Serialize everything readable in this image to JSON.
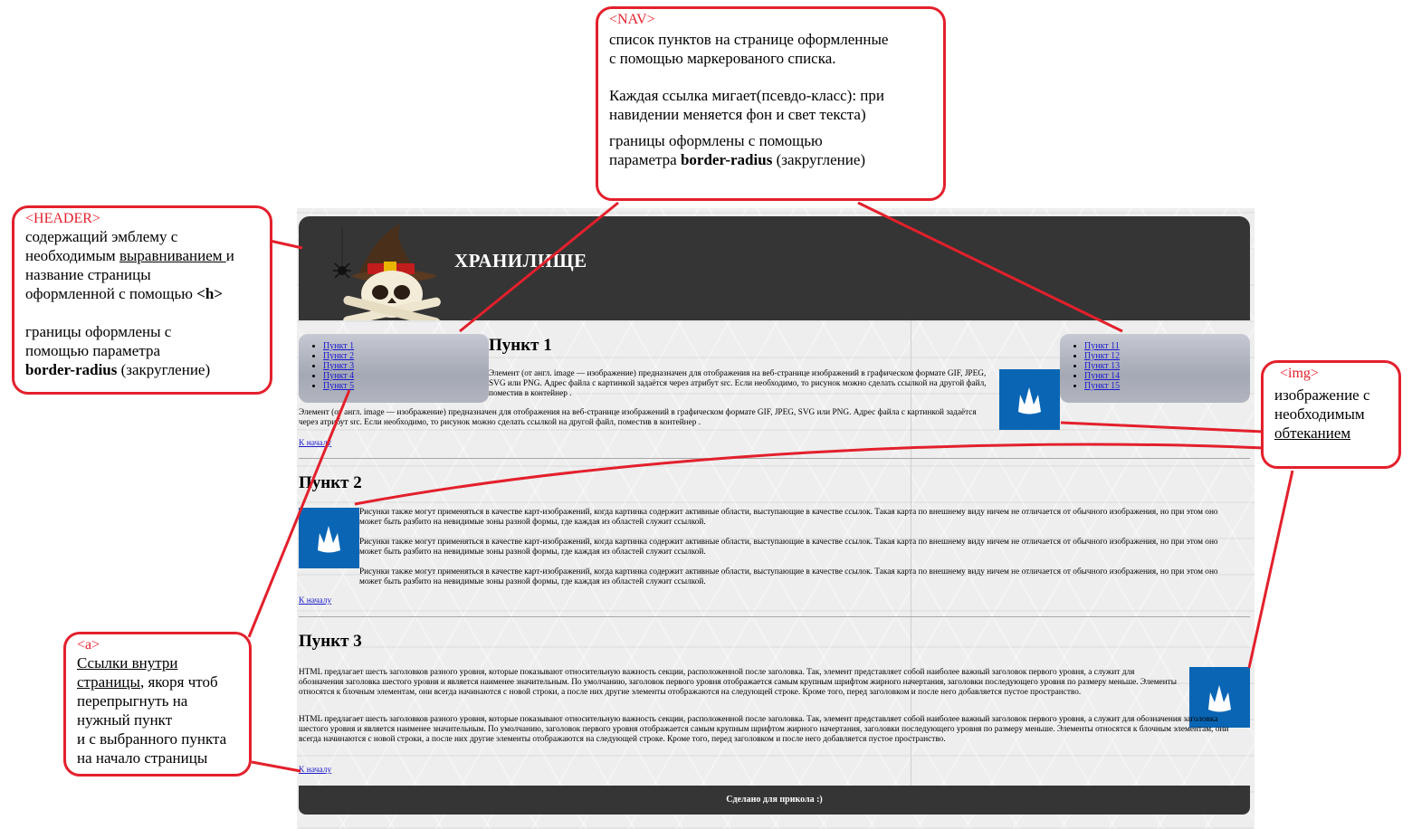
{
  "site": {
    "title": "ХРАНИЛИЩЕ",
    "nav_left": [
      "Пункт 1",
      "Пункт 2",
      "Пункт 3",
      "Пункт 4",
      "Пункт 5"
    ],
    "nav_right": [
      "Пункт 11",
      "Пункт 12",
      "Пункт 13",
      "Пункт 14",
      "Пункт 15"
    ],
    "section1": {
      "heading": "Пункт 1",
      "text_a": "Элемент  (от англ. image — изображение) предназначен для отображения на веб-странице изображений в графическом формате GIF, JPEG, SVG или PNG. Адрес файла с картинкой задаётся через атрибут src. Если необходимо, то рисунок можно сделать ссылкой на другой файл, поместив  в контейнер .",
      "text_b": "Элемент  (от англ. image — изображение) предназначен для отображения на веб-странице изображений в графическом формате GIF, JPEG, SVG или PNG. Адрес файла с картинкой задаётся через атрибут src. Если необходимо, то рисунок можно сделать ссылкой на другой файл, поместив  в контейнер .",
      "back": "К началу"
    },
    "section2": {
      "heading": "Пункт 2",
      "paragraph": "Рисунки также могут применяться в качестве карт-изображений, когда картинка содержит активные области, выступающие в качестве ссылок. Такая карта по внешнему виду ничем не отличается от обычного изображения, но при этом оно может быть разбито на невидимые зоны разной формы, где каждая из областей служит ссылкой.",
      "back": "К началу"
    },
    "section3": {
      "heading": "Пункт 3",
      "paragraph": "HTML предлагает шесть заголовков разного уровня, которые показывают относительную важность секции, расположенной после заголовка. Так, элемент представляет собой наиболее важный заголовок первого уровня, а служит для обозначения заголовка шестого уровня и является наименее значительным. По умолчанию, заголовок первого уровня отображается самым крупным шрифтом жирного начертания, заголовки последующего уровня по размеру меньше. Элементы относятся к блочным элементам, они всегда начинаются с новой строки, а после них другие элементы отображаются на следующей строке. Кроме того, перед заголовком и после него добавляется пустое пространство.",
      "back": "К началу"
    },
    "footer": "Сделано для прикола :)"
  },
  "callouts": {
    "nav": {
      "tag": "<NAV>",
      "line1": "список пунктов на странице оформленные",
      "line2": "с помощью маркерованого списка.",
      "line3": "Каждая ссылка мигает(псевдо-класс): при",
      "line4": "навидении меняется фон и свет текста)",
      "line5": "границы оформлены с  помощью",
      "line6_pre": "параметра ",
      "line6_bold": "border-radius",
      "line6_post": " (закругление)"
    },
    "header": {
      "tag": "<HEADER>",
      "line1": "содержащий эмблему с",
      "line2_pre": "необходимым ",
      "line2_u": "выравниванием ",
      "line2_post": "и",
      "line3": "название страницы",
      "line4_pre": "оформленной с помощью ",
      "line4_bold": "<h>",
      "line5": "границы оформлены с",
      "line6": "помощью параметра",
      "line7_bold": "border-radius",
      "line7_post": " (закругление)"
    },
    "img": {
      "tag": "<img>",
      "line1": "изображение с",
      "line2": "необходимым",
      "line3": "обтеканием"
    },
    "a": {
      "tag": "<a>",
      "line1": "Ссылки внутри ",
      "line2_u": "страницы",
      "line2_post": ", якоря чтоб",
      "line3": "перепрыгнуть на",
      "line4": "нужный пункт",
      "line5": "и с выбранного пункта",
      "line6": "на начало страницы"
    }
  },
  "colors": {
    "callout_border": "#e3202c",
    "header_bg": "#353535",
    "icon_blue": "#0a66b5"
  }
}
